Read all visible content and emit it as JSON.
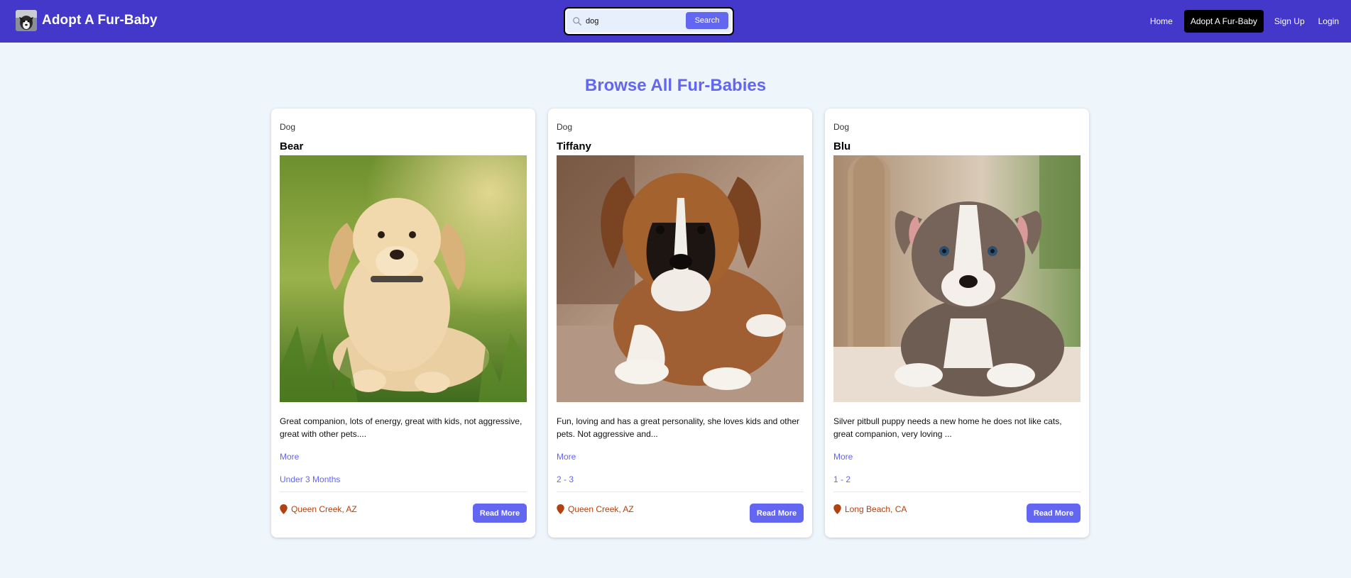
{
  "nav": {
    "brand": "Adopt A Fur-Baby",
    "search_value": "dog",
    "search_button": "Search",
    "links": [
      {
        "label": "Home"
      },
      {
        "label": "Adopt A Fur-Baby"
      },
      {
        "label": "Sign Up"
      },
      {
        "label": "Login"
      }
    ]
  },
  "main": {
    "title": "Browse All Fur-Babies",
    "cards": [
      {
        "type": "Dog",
        "name": "Bear",
        "photo": "golden-retriever-puppy",
        "description": "Great companion, lots of energy, great with kids, not aggressive, great with other pets....",
        "more": "More",
        "age": "Under 3 Months",
        "location": "Queen Creek, AZ",
        "button": "Read More"
      },
      {
        "type": "Dog",
        "name": "Tiffany",
        "photo": "boxer-puppy",
        "description": "Fun, loving and has a great personality, she loves kids and other pets. Not aggressive and...",
        "more": "More",
        "age": "2 - 3",
        "location": "Queen Creek, AZ",
        "button": "Read More"
      },
      {
        "type": "Dog",
        "name": "Blu",
        "photo": "pitbull-puppy",
        "description": "Silver pitbull puppy needs a new home he does not like cats, great companion, very loving ...",
        "more": "More",
        "age": "1 - 2",
        "location": "Long Beach, CA",
        "button": "Read More"
      }
    ]
  },
  "colors": {
    "navbar": "#4338ca",
    "accent": "#6366f1",
    "background": "#eef5fb",
    "location": "#b3410f"
  }
}
